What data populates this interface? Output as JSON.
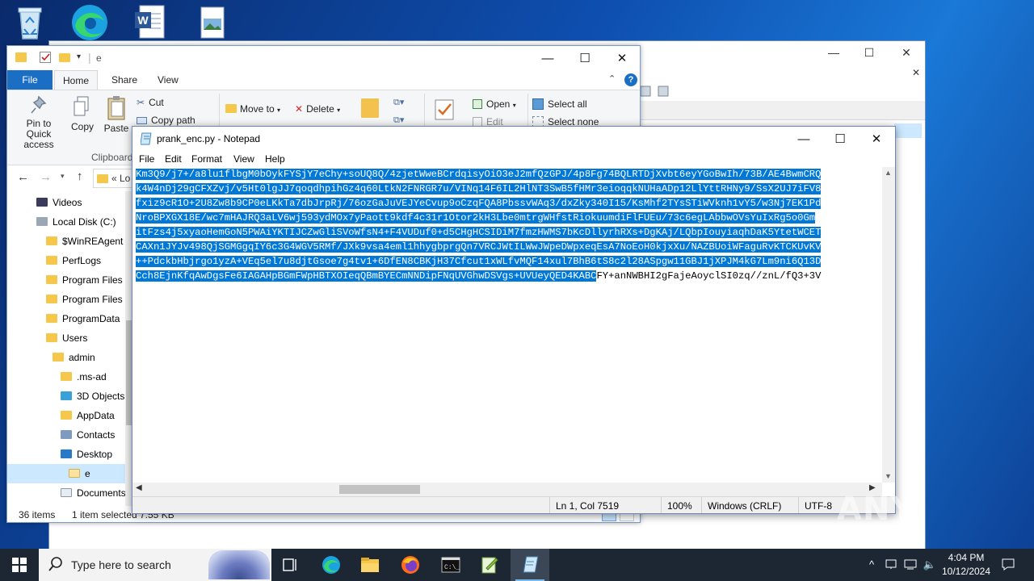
{
  "desktop": {
    "icons": [
      "recycle-bin-icon",
      "edge-icon",
      "word-document-icon",
      "image-file-icon"
    ]
  },
  "explorer": {
    "title": "e",
    "tabs": {
      "file": "File",
      "home": "Home",
      "share": "Share",
      "view": "View"
    },
    "ribbon": {
      "pin": "Pin to Quick access",
      "copy": "Copy",
      "paste": "Paste",
      "cut": "Cut",
      "copy_path": "Copy path",
      "clipboard": "Clipboard",
      "move_to": "Move to",
      "delete": "Delete",
      "open": "Open",
      "edit": "Edit",
      "select_all": "Select all",
      "select_none": "Select none"
    },
    "address": "« Lo",
    "tree": [
      {
        "label": "Videos",
        "icon": "videos-icon"
      },
      {
        "label": "Local Disk (C:)",
        "icon": "drive-icon"
      },
      {
        "label": "$WinREAgent",
        "icon": "folder-icon"
      },
      {
        "label": "PerfLogs",
        "icon": "folder-icon"
      },
      {
        "label": "Program Files",
        "icon": "folder-icon"
      },
      {
        "label": "Program Files",
        "icon": "folder-icon"
      },
      {
        "label": "ProgramData",
        "icon": "folder-icon"
      },
      {
        "label": "Users",
        "icon": "folder-icon"
      },
      {
        "label": "admin",
        "icon": "folder-icon"
      },
      {
        "label": ".ms-ad",
        "icon": "folder-icon"
      },
      {
        "label": "3D Objects",
        "icon": "3d-objects-icon"
      },
      {
        "label": "AppData",
        "icon": "folder-icon"
      },
      {
        "label": "Contacts",
        "icon": "contacts-icon"
      },
      {
        "label": "Desktop",
        "icon": "desktop-icon"
      },
      {
        "label": "e",
        "icon": "folder-icon"
      },
      {
        "label": "Documents",
        "icon": "documents-icon"
      }
    ],
    "status": {
      "items": "36 items",
      "selected": "1 item selected",
      "size": "7.55 KB"
    }
  },
  "notepad": {
    "title": "prank_enc.py - Notepad",
    "menu": [
      "File",
      "Edit",
      "Format",
      "View",
      "Help"
    ],
    "lines": [
      {
        "sel": "Km3Q9/j7+/a8lu1flbgM0bOykFYSjY7eChy+soUQ8Q/4zjetWweBCrdqisyOiO3eJ2mfQzGPJ/4p8Fg74BQLRTDjXvbt6eyYGoBwIh/73B/AE4BwmCRQ",
        "rest": ""
      },
      {
        "sel": "k4W4nDj29gCFXZvj/v5Ht0lgJJ7qoqdhpihGz4q60LtkN2FNRGR7u/VINq14F6IL2HlNT3SwB5fHMr3eioqqkNUHaADp12LlYttRHNy9/SsX2UJ7iFV8",
        "rest": ""
      },
      {
        "sel": "fxiz9cR1O+2U8Zw8b9CP0eLKkTa7dbJrpRj/76ozGaJuVEJYeCvup9oCzqFQA8PbssvWAq3/dxZky340I15/KsMhf2TYsSTiWVknh1vY5/w3Nj7EK1Pd",
        "rest": ""
      },
      {
        "sel": "NroBPXGX18E/wc7mHAJRQ3aLV6wj593ydMOx7yPaott9kdf4c31r1Otor2kH3Lbe0mtrgWHfstRiokuumdiFlFUEu/73c6egLAbbwOVsYuIxRg5o0Gm",
        "rest": ""
      },
      {
        "sel": "itFzs4j5xyaoHemGoN5PWAiYKTIJCZwGliSVoWfsN4+F4VUDuf0+d5CHgHCSIDiM7fmzHWMS7bKcDllyrhRXs+DgKAj/LQbpIouyiaqhDaK5YtetWCET",
        "rest": ""
      },
      {
        "sel": "CAXn1JYJv498QjSGMGgqIY6c3G4WGV5RMf/JXk9vsa4eml1hhygbprgQn7VRCJWtILWwJWpeDWpxeqEsA7NoEoH0kjxXu/NAZBUoiWFaguRvKTCKUvKV",
        "rest": ""
      },
      {
        "sel": "++PdckbHbjrgo1yzA+VEq5el7u8djtGsoe7g4tv1+6DfEN8CBKjH37Cfcut1xWLfvMQF14xul7BhB6tS8c2l28ASpgw11GBJ1jXPJM4kG7Lm9ni6Q13D",
        "rest": ""
      },
      {
        "sel": "Cch8EjnKfqAwDgsFe6IAGAHpBGmFWpHBTXOIeqQBmBYECmNNDipFNqUVGhwDSVgs+UVUeyQED4KABC",
        "rest": "FY+anNWBHI2gFajeAoyclSI0zq//znL/fQ3+3V"
      }
    ],
    "status": {
      "position": "Ln 1, Col 7519",
      "zoom": "100%",
      "line_ending": "Windows (CRLF)",
      "encoding": "UTF-8"
    }
  },
  "taskbar": {
    "search_placeholder": "Type here to search",
    "time": "4:04 PM",
    "date": "10/12/2024",
    "apps": [
      "task-view-icon",
      "edge-icon",
      "file-explorer-icon",
      "firefox-icon",
      "cmd-icon",
      "notepadpp-icon",
      "notepad-icon"
    ]
  },
  "watermark": "ANY RUN"
}
